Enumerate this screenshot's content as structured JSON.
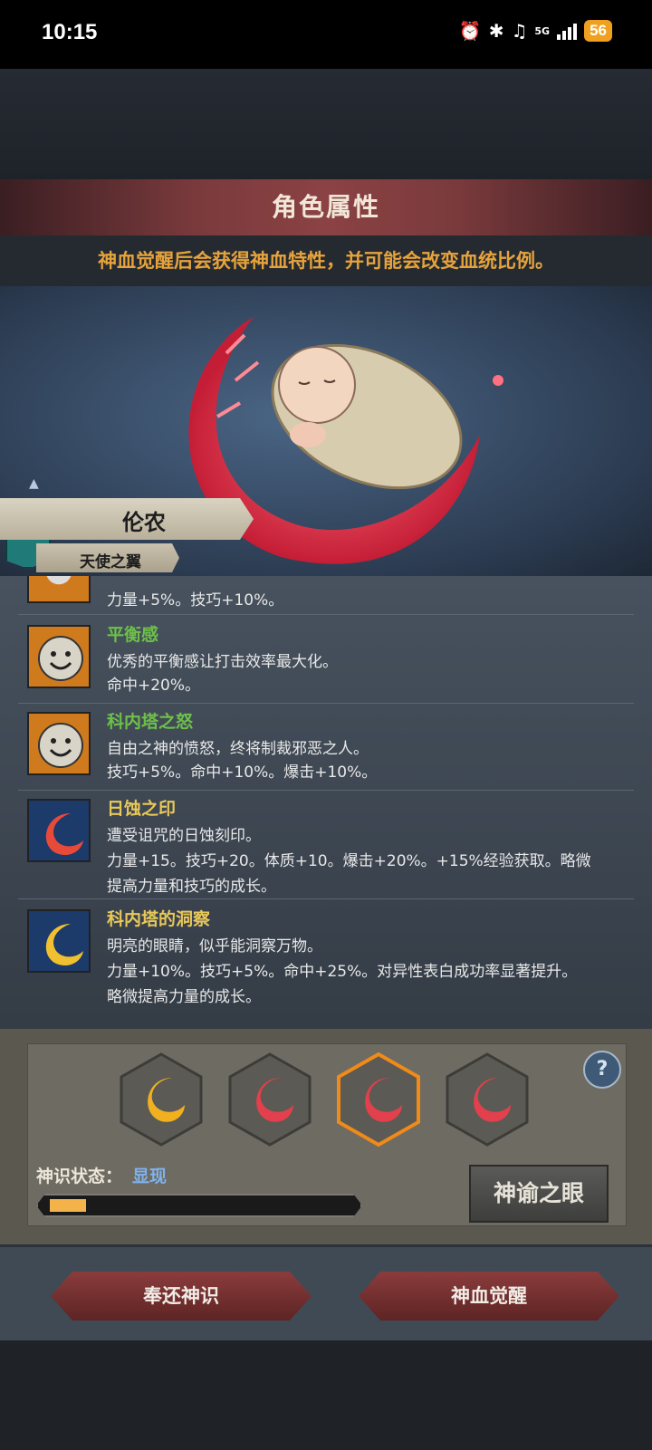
{
  "statusbar": {
    "time": "10:15",
    "network": "5G",
    "battery": "56"
  },
  "header": {
    "title": "角色属性",
    "subtitle": "神血觉醒后会获得神血特性，并可能会改变血统比例。"
  },
  "character": {
    "name": "伦农",
    "title": "天使之翼"
  },
  "traits": [
    {
      "name": "",
      "lines": [
        "力量+5%。技巧+10%。"
      ],
      "icon": "smiley-face-icon"
    },
    {
      "name": "平衡感",
      "name_color": "#6ec04a",
      "lines": [
        "优秀的平衡感让打击效率最大化。",
        "命中+20%。"
      ],
      "icon": "smiley-face-icon"
    },
    {
      "name": "科内塔之怒",
      "name_color": "#6ec04a",
      "lines": [
        "自由之神的愤怒，终将制裁邪恶之人。",
        "技巧+5%。命中+10%。爆击+10%。"
      ],
      "icon": "smiley-face-icon"
    },
    {
      "name": "日蚀之印",
      "name_color": "#e8c85a",
      "lines": [
        "遭受诅咒的日蚀刻印。",
        "力量+15。技巧+20。体质+10。爆击+20%。+15%经验获取。略微",
        "提高力量和技巧的成长。"
      ],
      "icon": "red-crescent-icon"
    },
    {
      "name": "科内塔的洞察",
      "name_color": "#e8c85a",
      "lines": [
        "明亮的眼睛，似乎能洞察万物。",
        "力量+10%。技巧+5%。命中+25%。对异性表白成功率显著提升。",
        "略微提高力量的成长。"
      ],
      "icon": "gold-crescent-icon"
    }
  ],
  "awakening": {
    "state_label": "神识状态：",
    "state_value": "显现",
    "progress": 0.12,
    "oracle_button": "神谕之眼",
    "help": "?"
  },
  "buttons": {
    "return": "奉还神识",
    "awaken": "神血觉醒"
  }
}
